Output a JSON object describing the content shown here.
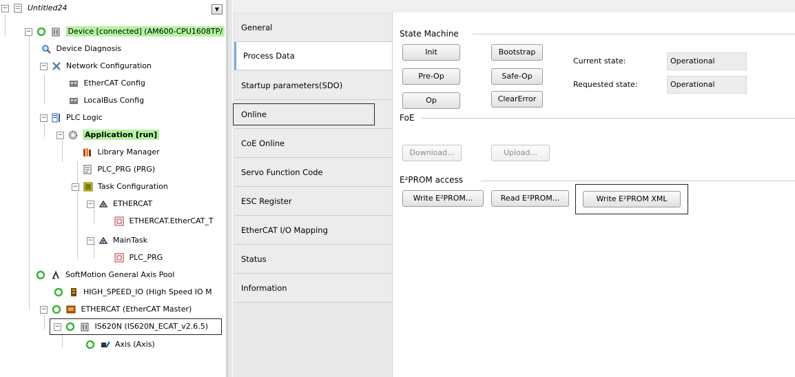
{
  "tree": {
    "root_label": "Untitled24",
    "items": [
      {
        "label": "Device [connected] (AM600-CPU1608TP/"
      },
      {
        "label": "Device Diagnosis"
      },
      {
        "label": "Network Configuration"
      },
      {
        "label": "EtherCAT Config"
      },
      {
        "label": "LocalBus Config"
      },
      {
        "label": "PLC Logic"
      },
      {
        "label": "Application [run]"
      },
      {
        "label": "Library Manager"
      },
      {
        "label": "PLC_PRG (PRG)"
      },
      {
        "label": "Task Configuration"
      },
      {
        "label": "ETHERCAT"
      },
      {
        "label": "ETHERCAT.EtherCAT_T"
      },
      {
        "label": "MainTask"
      },
      {
        "label": "PLC_PRG"
      },
      {
        "label": "SoftMotion General Axis Pool"
      },
      {
        "label": "HIGH_SPEED_IO (High Speed IO M"
      },
      {
        "label": "ETHERCAT (EtherCAT Master)"
      },
      {
        "label": "IS620N (IS620N_ECAT_v2.6.5)"
      },
      {
        "label": "Axis (Axis)"
      }
    ]
  },
  "tabs": [
    {
      "label": "General"
    },
    {
      "label": "Process Data"
    },
    {
      "label": "Startup parameters(SDO)"
    },
    {
      "label": "Online"
    },
    {
      "label": "CoE Online"
    },
    {
      "label": "Servo Function Code"
    },
    {
      "label": "ESC Register"
    },
    {
      "label": "EtherCAT I/O Mapping"
    },
    {
      "label": "Status"
    },
    {
      "label": "Information"
    }
  ],
  "state_machine": {
    "title": "State Machine",
    "init": "Init",
    "bootstrap": "Bootstrap",
    "preop": "Pre-Op",
    "safeop": "Safe-Op",
    "op": "Op",
    "clearerror": "ClearError",
    "current_label": "Current state:",
    "current_value": "Operational",
    "requested_label": "Requested state:",
    "requested_value": "Operational"
  },
  "foe": {
    "title": "FoE",
    "download": "Download...",
    "upload": "Upload..."
  },
  "eeprom": {
    "title": "E²PROM access",
    "write": "Write E²PROM...",
    "read": "Read E²PROM...",
    "write_xml": "Write E²PROM XML"
  },
  "colors": {
    "highlight_green": "#b3f3a0",
    "active_tab_accent": "#7aa8d8"
  }
}
